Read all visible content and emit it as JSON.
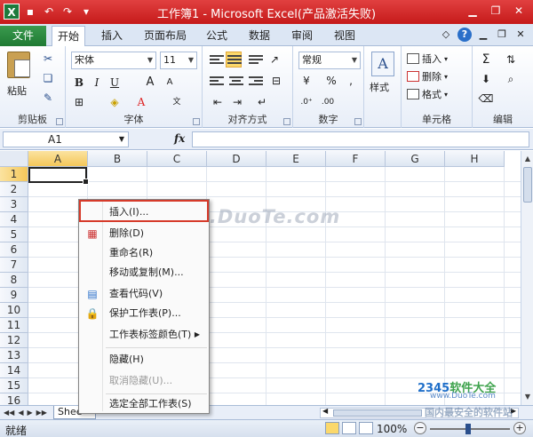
{
  "window": {
    "title": "工作簿1 - Microsoft Excel(产品激活失败)",
    "app_icon": "X"
  },
  "ribbon_tabs": {
    "file": "文件",
    "items": [
      "开始",
      "插入",
      "页面布局",
      "公式",
      "数据",
      "审阅",
      "视图"
    ],
    "active": "开始"
  },
  "clipboard": {
    "paste_label": "粘贴",
    "group_label": "剪贴板"
  },
  "font": {
    "name": "宋体",
    "size": "11",
    "bold": "B",
    "italic": "I",
    "underline": "U",
    "grow": "A",
    "shrink": "A",
    "group_label": "字体"
  },
  "alignment": {
    "group_label": "对齐方式"
  },
  "number": {
    "format": "常规",
    "percent": "%",
    "comma": ",",
    "group_label": "数字"
  },
  "styles": {
    "label": "样式"
  },
  "cells": {
    "insert": "插入",
    "delete": "删除",
    "format": "格式",
    "group_label": "单元格"
  },
  "editing": {
    "group_label": "编辑",
    "sum": "Σ"
  },
  "formula_bar": {
    "name_box": "A1",
    "fx": "fx"
  },
  "grid": {
    "columns": [
      "A",
      "B",
      "C",
      "D",
      "E",
      "F",
      "G",
      "H"
    ],
    "rows": [
      "1",
      "2",
      "3",
      "4",
      "5",
      "6",
      "7",
      "8",
      "9",
      "10",
      "11",
      "12",
      "13",
      "14",
      "15",
      "16"
    ],
    "active_cell": "A1"
  },
  "context_menu": {
    "items": [
      {
        "label": "插入(I)...",
        "icon": "none",
        "disabled": false
      },
      {
        "label": "删除(D)",
        "icon": "delete-sheet-icon",
        "disabled": false
      },
      {
        "label": "重命名(R)",
        "icon": "none",
        "disabled": false
      },
      {
        "label": "移动或复制(M)...",
        "icon": "none",
        "disabled": false
      },
      {
        "label": "查看代码(V)",
        "icon": "view-code-icon",
        "disabled": false
      },
      {
        "label": "保护工作表(P)...",
        "icon": "protect-sheet-icon",
        "disabled": false
      },
      {
        "label": "工作表标签颜色(T)",
        "icon": "none",
        "disabled": false,
        "submenu": true
      },
      {
        "label": "隐藏(H)",
        "icon": "none",
        "disabled": false
      },
      {
        "label": "取消隐藏(U)...",
        "icon": "none",
        "disabled": true
      },
      {
        "label": "选定全部工作表(S)",
        "icon": "none",
        "disabled": false
      }
    ]
  },
  "sheet_bar": {
    "tab_label": "Shee"
  },
  "status_bar": {
    "status": "就绪",
    "zoom": "100%"
  },
  "watermarks": {
    "center": "www.DuoTe.com",
    "logo_main": "2345",
    "logo_sub": "软件大全",
    "url": "www.DuoTe.com",
    "cn": "国内最安全的软件站"
  },
  "colors": {
    "titlebar": "#d42a2a",
    "file_tab": "#1f7a33",
    "highlight": "#d63a2a"
  }
}
